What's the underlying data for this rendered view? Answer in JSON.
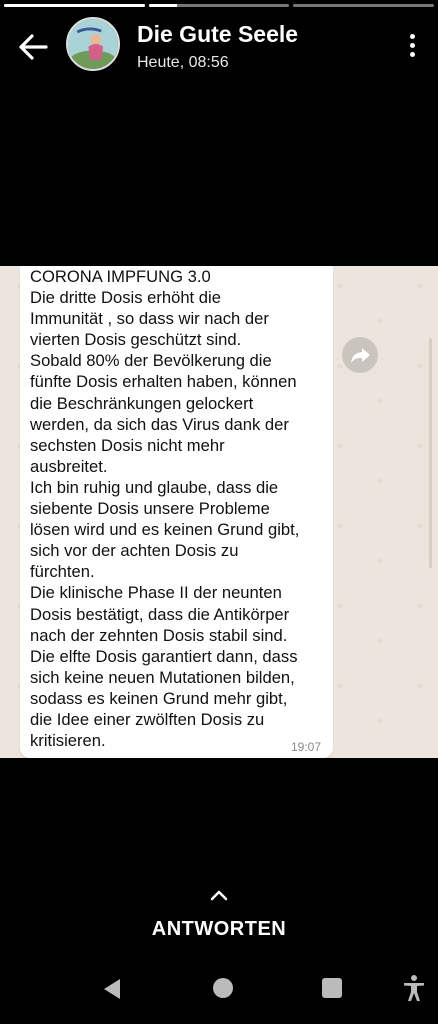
{
  "progress": {
    "segments": [
      1,
      0.2,
      0
    ]
  },
  "header": {
    "back_icon": "arrow-left-icon",
    "avatar": "contact-avatar",
    "contact_name": "Die Gute Seele",
    "status_time": "Heute, 08:56",
    "menu_icon": "more-vert-icon"
  },
  "message": {
    "text": "CORONA IMPFUNG 3.0\nDie dritte Dosis erhöht die\nImmunität , so dass wir nach der\nvierten Dosis geschützt sind.\nSobald 80% der Bevölkerung die\nfünfte Dosis erhalten haben, können\ndie Beschränkungen gelockert\nwerden, da sich das Virus dank der\nsechsten Dosis nicht mehr\nausbreitet.\nIch bin ruhig und glaube, dass die\nsiebente Dosis unsere Probleme\nlösen wird und es keinen Grund gibt,\nsich vor der achten Dosis zu\nfürchten.\nDie klinische Phase II der neunten\nDosis bestätigt, dass die Antikörper\nnach der zehnten Dosis stabil sind.\nDie elfte Dosis garantiert dann, dass\nsich keine neuen Mutationen bilden,\nsodass es keinen Grund mehr gibt,\ndie Idee einer zwölften Dosis zu\nkritisieren.",
    "time": "19:07",
    "forward_icon": "share-forward-icon"
  },
  "reply": {
    "label": "ANTWORTEN",
    "icon": "chevron-up-icon"
  },
  "navbar": {
    "back": "nav-back-icon",
    "home": "nav-home-icon",
    "recents": "nav-recents-icon",
    "accessibility": "accessibility-icon"
  },
  "colors": {
    "chat_bg": "#ece5dd",
    "bubble": "#ffffff",
    "text": "#111111",
    "time": "#8a8a8a"
  }
}
